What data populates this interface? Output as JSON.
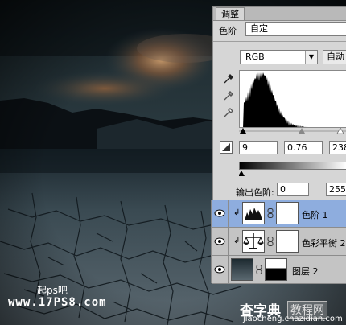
{
  "panel": {
    "tab_label": "调整",
    "preset_label": "色阶",
    "preset_value": "自定",
    "channel_value": "RGB",
    "auto_button": "自动",
    "input_black": "9",
    "input_gamma": "0.76",
    "input_white": "238",
    "output_label": "输出色阶:",
    "output_black": "0",
    "output_white": "255"
  },
  "layers": [
    {
      "name": "色阶 1",
      "selected": true,
      "icon": "levels-icon"
    },
    {
      "name": "色彩平衡 2",
      "selected": false,
      "icon": "color-balance-icon"
    },
    {
      "name": "图层 2",
      "selected": false,
      "icon": "image-thumbnail"
    }
  ],
  "watermarks": {
    "top_left": "一起ps吧",
    "domain_left": "www.17PS8.com",
    "site_name": "查字典",
    "site_tag": "教程网",
    "site_url": "jiaocheng.chazidian.com"
  },
  "colors": {
    "selected_layer": "#8eadde",
    "panel_bg": "#d6d6d6",
    "layers_bg": "#c4c4c4"
  }
}
